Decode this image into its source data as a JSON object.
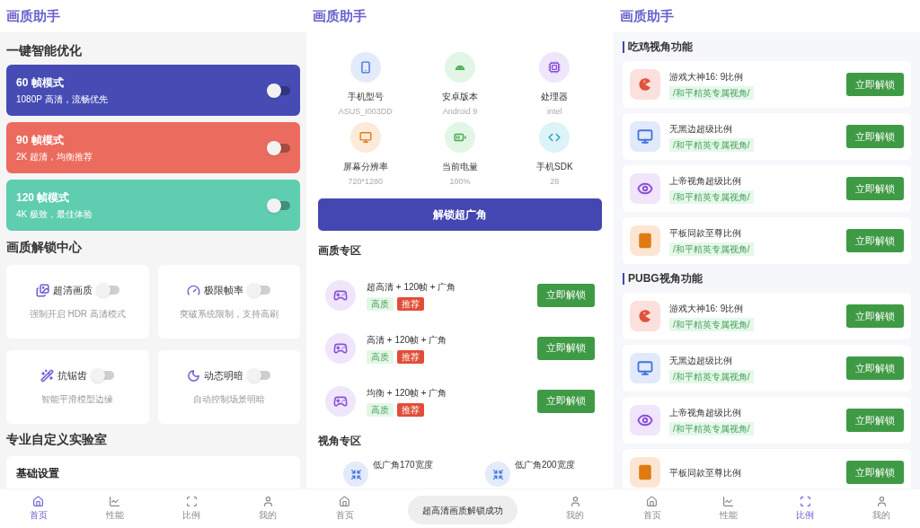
{
  "home_screen": {
    "title": "画质助手",
    "quick_title": "一键智能优化",
    "modes": [
      {
        "name": "60 帧模式",
        "desc": "1080P 高清，流畅优先",
        "on": false,
        "color": "#464cb3"
      },
      {
        "name": "90 帧模式",
        "desc": "2K 超清，均衡推荐",
        "on": false,
        "color": "#eb6c5e"
      },
      {
        "name": "120 帧模式",
        "desc": "4K 极致，最佳体验",
        "on": false,
        "color": "#5ecdb0"
      }
    ],
    "unlock_title": "画质解锁中心",
    "features": [
      {
        "name": "超清画质",
        "desc": "强制开启 HDR 高清模式",
        "on": false
      },
      {
        "name": "极限帧率",
        "desc": "突破系统限制，支持高刷",
        "on": false
      },
      {
        "name": "抗锯齿",
        "desc": "智能平滑模型边缘",
        "on": false
      },
      {
        "name": "动态明暗",
        "desc": "自动控制场景明暗",
        "on": false
      }
    ],
    "lab_title": "专业自定义实验室",
    "lab_card_title": "基础设置",
    "tabs": [
      {
        "label": "首页",
        "selected": true
      },
      {
        "label": "性能",
        "selected": false
      },
      {
        "label": "比例",
        "selected": false
      },
      {
        "label": "我的",
        "selected": false
      }
    ]
  },
  "device_screen": {
    "title": "画质助手",
    "specs": [
      {
        "label": "手机型号",
        "value": "ASUS_I003DD"
      },
      {
        "label": "安卓版本",
        "value": "Android 9"
      },
      {
        "label": "处理器",
        "value": "intel"
      },
      {
        "label": "屏幕分辨率",
        "value": "720*1280"
      },
      {
        "label": "当前电量",
        "value": "100%"
      },
      {
        "label": "手机SDK",
        "value": "28"
      }
    ],
    "unlock_button": "解锁超广角",
    "quality_title": "画质专区",
    "quality_items": [
      {
        "name": "超高清 + 120帧 + 广角",
        "tags": [
          {
            "text": "高质",
            "kind": "quality"
          },
          {
            "text": "推荐",
            "kind": "hot"
          }
        ],
        "button": "立即解锁"
      },
      {
        "name": "高清 + 120帧 + 广角",
        "tags": [
          {
            "text": "高质",
            "kind": "quality"
          },
          {
            "text": "推荐",
            "kind": "hot"
          }
        ],
        "button": "立即解锁"
      },
      {
        "name": "均衡 + 120帧 + 广角",
        "tags": [
          {
            "text": "高质",
            "kind": "quality"
          },
          {
            "text": "推荐",
            "kind": "hot"
          }
        ],
        "button": "立即解锁"
      }
    ],
    "view_title": "视角专区",
    "view_items": [
      {
        "name": "低广角170宽度"
      },
      {
        "name": "低广角200宽度"
      }
    ],
    "toast": "超高清画质解锁成功",
    "tabs": [
      {
        "label": "首页",
        "selected": false
      },
      {
        "label": "我的",
        "selected": false
      }
    ]
  },
  "ratio_screen": {
    "title": "画质助手",
    "groups": [
      {
        "title": "吃鸡视角功能",
        "items": [
          {
            "name": "游戏大神16: 9比例",
            "tag": "/和平精英专属视角/",
            "button": "立即解锁"
          },
          {
            "name": "无黑边超级比例",
            "tag": "/和平精英专属视角/",
            "button": "立即解锁"
          },
          {
            "name": "上帝视角超级比例",
            "tag": "/和平精英专属视角/",
            "button": "立即解锁"
          },
          {
            "name": "平板同款至尊比例",
            "tag": "/和平精英专属视角/",
            "button": "立即解锁"
          }
        ]
      },
      {
        "title": "PUBG视角功能",
        "items": [
          {
            "name": "游戏大神16: 9比例",
            "tag": "/和平精英专属视角/",
            "button": "立即解锁"
          },
          {
            "name": "无黑边超级比例",
            "tag": "/和平精英专属视角/",
            "button": "立即解锁"
          },
          {
            "name": "上帝视角超级比例",
            "tag": "/和平精英专属视角/",
            "button": "立即解锁"
          },
          {
            "name": "平板同款至尊比例",
            "button": "立即解锁"
          }
        ]
      }
    ],
    "tabs": [
      {
        "label": "首页",
        "selected": false
      },
      {
        "label": "性能",
        "selected": false
      },
      {
        "label": "比例",
        "selected": true
      },
      {
        "label": "我的",
        "selected": false
      }
    ]
  }
}
